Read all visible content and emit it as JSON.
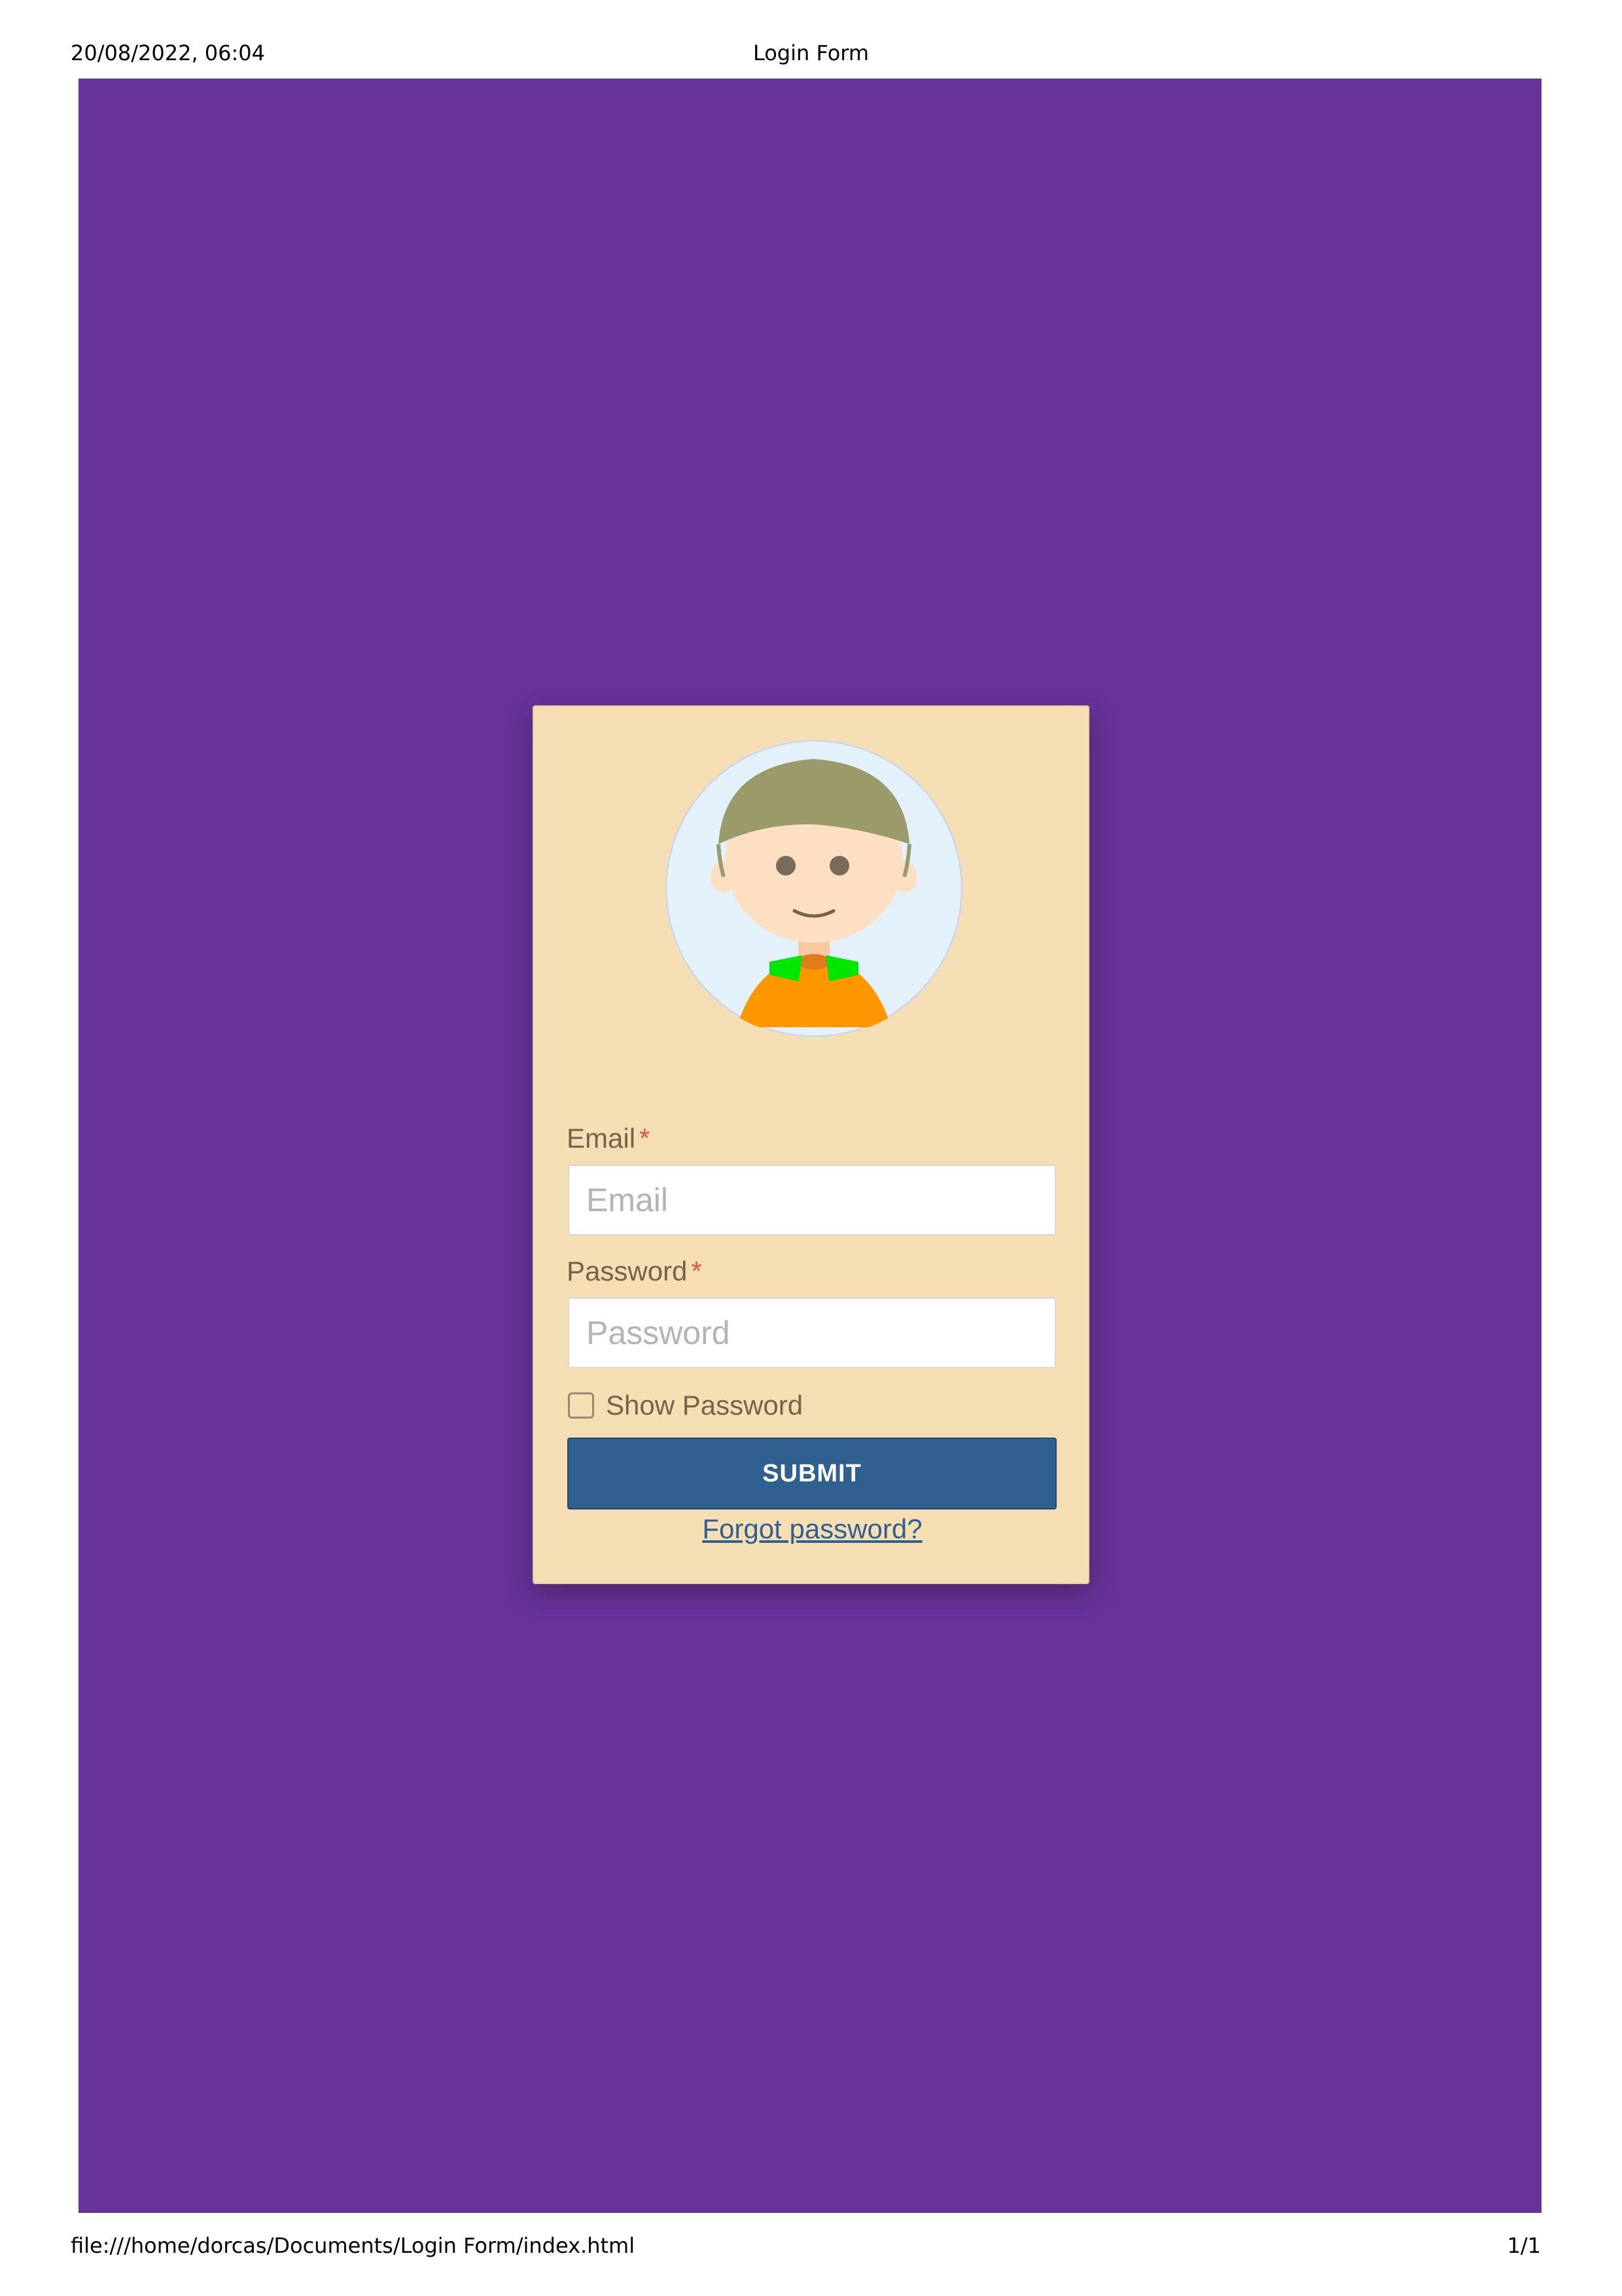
{
  "print_header": {
    "datetime": "20/08/2022, 06:04",
    "title": "Login Form"
  },
  "print_footer": {
    "file_path": "file:///home/dorcas/Documents/Login Form/index.html",
    "page_count": "1/1"
  },
  "colors": {
    "page_background": "#663399",
    "card_background": "#f5deb3",
    "button_background": "#306090",
    "required_marker": "#e0584a"
  },
  "login_form": {
    "avatar_icon": "user-avatar-icon",
    "email_label": "Email",
    "email_required": "*",
    "email_placeholder": "Email",
    "email_value": "",
    "password_label": "Password",
    "password_required": "*",
    "password_placeholder": "Password",
    "password_value": "",
    "show_password_label": "Show Password",
    "show_password_checked": false,
    "submit_label": "SUBMIT",
    "forgot_password_label": "Forgot password?"
  }
}
